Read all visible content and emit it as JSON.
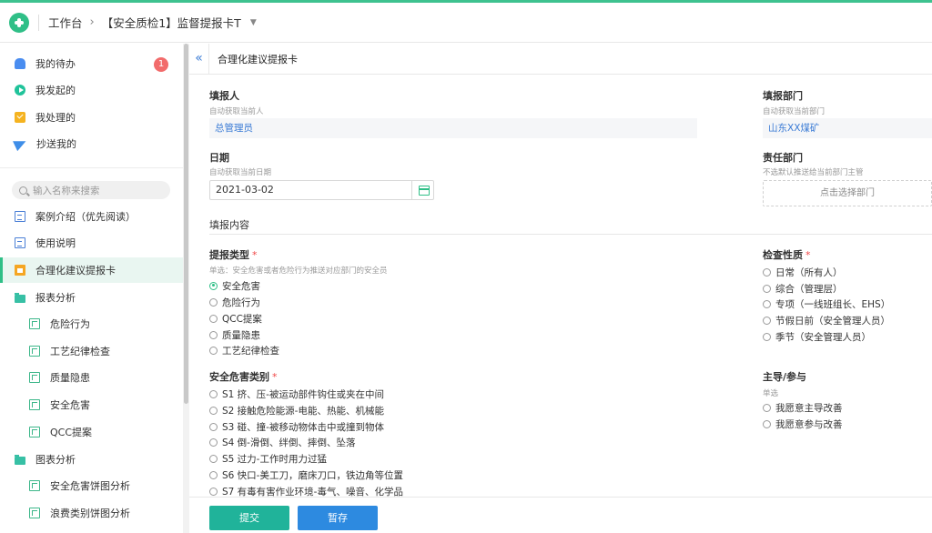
{
  "header": {
    "workbench": "工作台",
    "form_name": "【安全质检1】监督提报卡T"
  },
  "sidebar": {
    "top_items": [
      {
        "label": "我的待办",
        "icon": "bell-icon",
        "badge": "1"
      },
      {
        "label": "我发起的",
        "icon": "play-circle-icon"
      },
      {
        "label": "我处理的",
        "icon": "checkbox-icon"
      },
      {
        "label": "抄送我的",
        "icon": "send-icon"
      }
    ],
    "search_placeholder": "输入名称来搜索",
    "items": [
      {
        "label": "案例介绍（优先阅读）",
        "icon": "document-icon"
      },
      {
        "label": "使用说明",
        "icon": "document-icon"
      },
      {
        "label": "合理化建议提报卡",
        "icon": "clipboard-icon",
        "active": true
      },
      {
        "label": "报表分析",
        "icon": "folder-icon"
      },
      {
        "label": "危险行为",
        "icon": "sheet-icon"
      },
      {
        "label": "工艺纪律检查",
        "icon": "sheet-icon"
      },
      {
        "label": "质量隐患",
        "icon": "sheet-icon"
      },
      {
        "label": "安全危害",
        "icon": "sheet-icon"
      },
      {
        "label": "QCC提案",
        "icon": "sheet-icon"
      },
      {
        "label": "图表分析",
        "icon": "folder-icon"
      },
      {
        "label": "安全危害饼图分析",
        "icon": "sheet-icon"
      },
      {
        "label": "浪费类别饼图分析",
        "icon": "sheet-icon"
      }
    ]
  },
  "main": {
    "title": "合理化建议提报卡",
    "reporter": {
      "label": "填报人",
      "hint": "自动获取当前人",
      "value": "总管理员"
    },
    "dept": {
      "label": "填报部门",
      "hint": "自动获取当前部门",
      "value": "山东XX煤矿"
    },
    "date": {
      "label": "日期",
      "hint": "自动获取当前日期",
      "value": "2021-03-02"
    },
    "resp_dept": {
      "label": "责任部门",
      "hint": "不选默认推送给当前部门主管",
      "placeholder": "点击选择部门"
    },
    "section_title": "填报内容",
    "report_type": {
      "label": "提报类型",
      "required": "*",
      "hint": "单选：安全危害或者危险行为推送对应部门的安全员",
      "options": [
        "安全危害",
        "危险行为",
        "QCC提案",
        "质量隐患",
        "工艺纪律检查"
      ],
      "selected": "安全危害"
    },
    "inspect_nature": {
      "label": "检查性质",
      "required": "*",
      "options": [
        "日常（所有人）",
        "综合（管理层）",
        "专项（一线班组长、EHS）",
        "节假日前（安全管理人员）",
        "季节（安全管理人员）"
      ]
    },
    "hazard_category": {
      "label": "安全危害类别",
      "required": "*",
      "options": [
        "S1 挤、压-被运动部件钩住或夹在中间",
        "S2 接触危险能源-电能、热能、机械能",
        "S3 碰、撞-被移动物体击中或撞到物体",
        "S4 倒-滑倒、绊倒、摔倒、坠落",
        "S5 过力-工作时用力过猛",
        "S6 快口-美工刀，磨床刀口，铁边角等位置",
        "S7 有毒有害作业环境-毒气、噪音、化学品"
      ]
    },
    "lead": {
      "label": "主导/参与",
      "hint": "单选",
      "options": [
        "我愿意主导改善",
        "我愿意参与改善"
      ]
    }
  },
  "footer": {
    "submit": "提交",
    "save": "暂存"
  },
  "colors": {
    "accent": "#2fbf87",
    "submit": "#20b39a",
    "save": "#2d8ae0",
    "required": "#f04848",
    "badge": "#f26b6b"
  }
}
